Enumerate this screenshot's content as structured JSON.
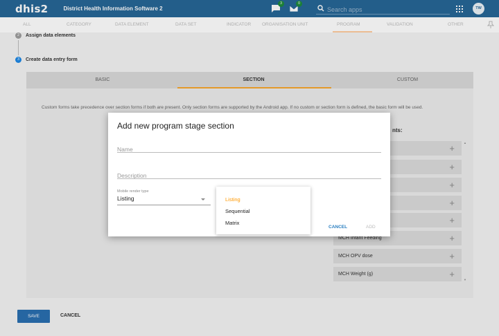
{
  "header": {
    "logo": "dhis2",
    "app_title": "District Health Information Software 2",
    "messages_count": "3",
    "interpretations_count": "0",
    "search_placeholder": "Search apps",
    "avatar_initials": "TW"
  },
  "top_tabs": [
    "ALL",
    "CATEGORY",
    "DATA ELEMENT",
    "DATA SET",
    "INDICATOR",
    "ORGANISATION UNIT",
    "PROGRAM",
    "VALIDATION",
    "OTHER"
  ],
  "steps": [
    {
      "num": "2",
      "label": "Assign data elements",
      "color": "#9e9e9e"
    },
    {
      "num": "3",
      "label": "Create data entry form",
      "color": "#1e88e5"
    }
  ],
  "form_tabs": {
    "basic": "BASIC",
    "section": "SECTION",
    "custom": "CUSTOM"
  },
  "form_description": "Custom forms take precedence over section forms if both are present. Only section forms are supported by the Android app. If no custom or section form is defined, the basic form will be used.",
  "available_title": "nts:",
  "data_elements": [
    "",
    "",
    "",
    "",
    "",
    "MCH Infant Feeding",
    "MCH OPV dose",
    "MCH Weight (g)"
  ],
  "actions": {
    "save": "SAVE",
    "cancel": "CANCEL"
  },
  "dialog": {
    "title": "Add new program stage section",
    "name_placeholder": "Name",
    "description_placeholder": "Description",
    "render_label": "Mobile render type",
    "render_value": "Listing",
    "cancel": "CANCEL",
    "add": "ADD"
  },
  "render_options": [
    "Listing",
    "Sequential",
    "Matrix"
  ],
  "colors": {
    "header": "#276696",
    "accent": "#ff9800",
    "primary": "#2a6fb0"
  }
}
